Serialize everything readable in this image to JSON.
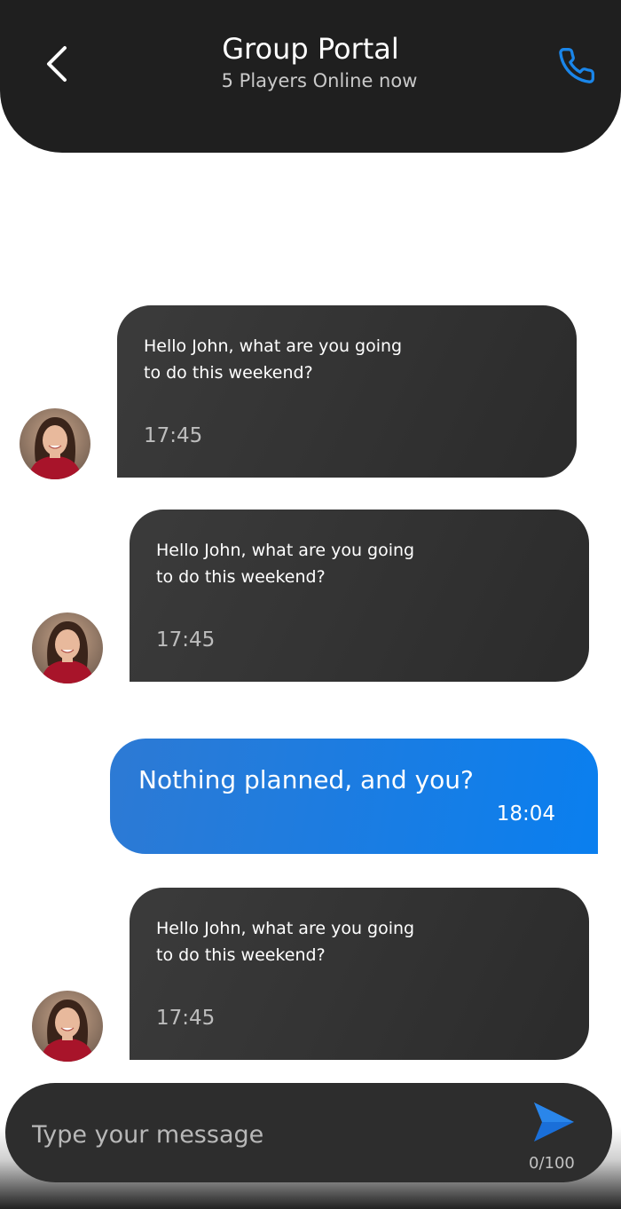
{
  "header": {
    "title": "Group Portal",
    "subtitle": "5 Players Online now",
    "back_icon": "chevron-left-icon",
    "call_icon": "phone-icon"
  },
  "messages": [
    {
      "direction": "incoming",
      "text": "Hello John, what are you going to do this weekend?",
      "time": "17:45"
    },
    {
      "direction": "incoming",
      "text": "Hello John, what are you going to do this weekend?",
      "time": "17:45"
    },
    {
      "direction": "outgoing",
      "text": "Nothing planned, and you?",
      "time": "18:04"
    },
    {
      "direction": "incoming",
      "text": "Hello John, what are you going to do this weekend?",
      "time": "17:45"
    }
  ],
  "composer": {
    "placeholder": "Type your message",
    "value": "",
    "char_count": "0/100",
    "send_icon": "send-icon"
  },
  "colors": {
    "header_bg": "#1f1f1f",
    "accent_blue": "#0a7fef",
    "incoming_bubble": "#2e2e2e",
    "composer_bg": "#2d2d2d"
  }
}
